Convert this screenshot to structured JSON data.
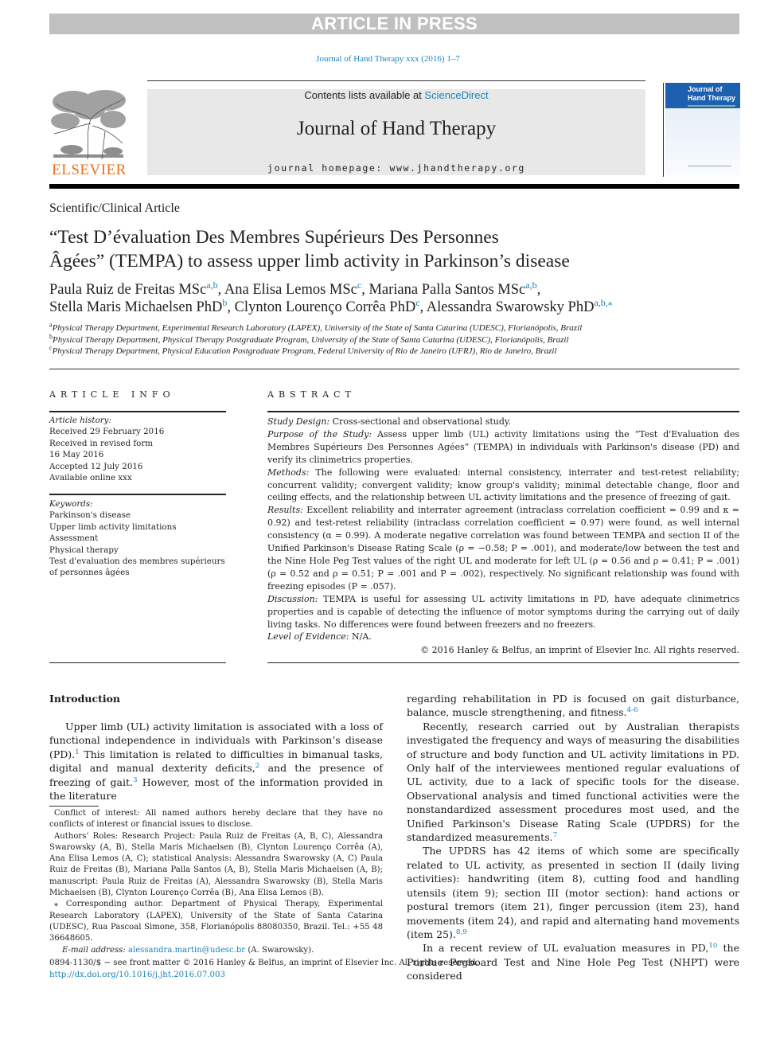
{
  "banner": {
    "text": "ARTICLE IN PRESS"
  },
  "journal_citation": "Journal of Hand Therapy xxx (2016) 1–7",
  "masthead": {
    "publisher_logo_text": "ELSEVIER",
    "contents_prefix": "Contents lists available at ",
    "contents_link": "ScienceDirect",
    "journal_title": "Journal of Hand Therapy",
    "homepage": "journal homepage: www.jhandtherapy.org",
    "cover_title_line1": "Journal of",
    "cover_title_line2": "Hand Therapy"
  },
  "article": {
    "type": "Scientific/Clinical Article",
    "title_line1": "“Test D’évaluation Des Membres Supérieurs Des Personnes",
    "title_line2": "Âgées” (TEMPA) to assess upper limb activity in Parkinson’s disease",
    "authors": [
      {
        "name": "Paula Ruiz de Freitas MSc",
        "aff": "a,b",
        "sep": ", "
      },
      {
        "name": "Ana Elisa Lemos MSc",
        "aff": "c",
        "sep": ", "
      },
      {
        "name": "Mariana Palla Santos MSc",
        "aff": "a,b",
        "sep": ","
      },
      {
        "name": "Stella Maris Michaelsen PhD",
        "aff": "b",
        "sep": ", "
      },
      {
        "name": "Clynton Lourenço Corrêa PhD",
        "aff": "c",
        "sep": ", "
      },
      {
        "name": "Alessandra Swarowsky PhD",
        "aff": "a,b,⁎",
        "sep": ""
      }
    ],
    "affiliations": [
      {
        "key": "a",
        "text": "Physical Therapy Department, Experimental Research Laboratory (LAPEX), University of the State of Santa Catarina (UDESC), Florianópolis, Brazil"
      },
      {
        "key": "b",
        "text": "Physical Therapy Department, Physical Therapy Postgraduate Program, University of the State of Santa Catarina (UDESC), Florianópolis, Brazil"
      },
      {
        "key": "c",
        "text": "Physical Therapy Department, Physical Education Postgraduate Program, Federal University of Rio de Janeiro (UFRJ), Rio de Janeiro, Brazil"
      }
    ]
  },
  "article_info": {
    "heading": "ARTICLE INFO",
    "history_label": "Article history:",
    "history": [
      "Received 29 February 2016",
      "Received in revised form",
      "16 May 2016",
      "Accepted 12 July 2016",
      "Available online xxx"
    ],
    "keywords_label": "Keywords:",
    "keywords": [
      "Parkinson's disease",
      "Upper limb activity limitations",
      "Assessment",
      "Physical therapy",
      "Test d'evaluation des membres supérieurs",
      "of personnes âgées"
    ]
  },
  "abstract": {
    "heading": "ABSTRACT",
    "sections": [
      {
        "label": "Study Design:",
        "text": " Cross-sectional and observational study."
      },
      {
        "label": "Purpose of the Study:",
        "text": " Assess upper limb (UL) activity limitations using the “Test d'Evaluation des Membres Supérieurs Des Personnes Agées” (TEMPA) in individuals with Parkinson's disease (PD) and verify its clinimetrics properties."
      },
      {
        "label": "Methods:",
        "text": " The following were evaluated: internal consistency, interrater and test-retest reliability; concurrent validity; convergent validity; know group's validity; minimal detectable change, floor and ceiling effects, and the relationship between UL activity limitations and the presence of freezing of gait."
      },
      {
        "label": "Results:",
        "text": " Excellent reliability and interrater agreement (intraclass correlation coefficient = 0.99 and κ = 0.92) and test-retest reliability (intraclass correlation coefficient = 0.97) were found, as well internal consistency (α = 0.99). A moderate negative correlation was found between TEMPA and section II of the Unified Parkinson's Disease Rating Scale (ρ = −0.58; P = .001), and moderate/low between the test and the Nine Hole Peg Test values of the right UL and moderate for left UL (ρ = 0.56 and ρ = 0.41; P = .001) (ρ = 0.52 and ρ = 0.51; P = .001 and P = .002), respectively. No significant relationship was found with freezing episodes (P = .057)."
      },
      {
        "label": "Discussion:",
        "text": " TEMPA is useful for assessing UL activity limitations in PD, have adequate clinimetrics properties and is capable of detecting the influence of motor symptoms during the carrying out of daily living tasks. No differences were found between freezers and no freezers."
      },
      {
        "label": "Level of Evidence:",
        "text": " N/A."
      }
    ],
    "copyright": "© 2016 Hanley & Belfus, an imprint of Elsevier Inc. All rights reserved."
  },
  "introduction": {
    "heading": "Introduction",
    "left_para": {
      "t1": "Upper limb (UL) activity limitation is associated with a loss of functional independence in individuals with Parkinson’s disease (PD).",
      "r1": "1",
      "t2": " This limitation is related to difficulties in bimanual tasks, digital and manual dexterity deficits,",
      "r2": "2",
      "t3": " and the presence of freezing of gait.",
      "r3": "3",
      "t4": " However, most of the information provided in the literature"
    },
    "right_paras": [
      {
        "t1": "regarding rehabilitation in PD is focused on gait disturbance, balance, muscle strengthening, and fitness.",
        "r1": "4-6"
      },
      {
        "t1": "Recently, research carried out by Australian therapists investigated the frequency and ways of measuring the disabilities of structure and body function and UL activity limitations in PD. Only half of the interviewees mentioned regular evaluations of UL activity, due to a lack of specific tools for the disease. Observational analysis and timed functional activities were the nonstandardized assessment procedures most used, and the Unified Parkinson's Disease Rating Scale (UPDRS) for the standardized measurements.",
        "r1": "7"
      },
      {
        "t1": "The UPDRS has 42 items of which some are specifically related to UL activity, as presented in section II (daily living activities): handwriting (item 8), cutting food and handling utensils (item 9); section III (motor section): hand actions or postural tremors (item 21), finger percussion (item 23), hand movements (item 24), and rapid and alternating hand movements (item 25).",
        "r1": "8,9"
      },
      {
        "t1": "In a recent review of UL evaluation measures in PD,",
        "r1": "10",
        "t2": " the Purdue Pegboard Test and Nine Hole Peg Test (NHPT) were considered"
      }
    ]
  },
  "footnotes": {
    "conflict": "Conflict of interest: All named authors hereby declare that they have no conflicts of interest or financial issues to disclose.",
    "roles": "Authors’ Roles: Research Project: Paula Ruiz de Freitas (A, B, C), Alessandra Swarowsky (A, B), Stella Maris Michaelsen (B), Clynton Lourenço Corrêa (A), Ana Elisa Lemos (A, C); statistical Analysis: Alessandra Swarowsky (A, C) Paula Ruiz de Freitas (B), Mariana Palla Santos (A, B), Stella Maris Michaelsen (A, B); manuscript: Paula Ruiz de Freitas (A), Alessandra Swarowsky (B), Stella Maris Michaelsen (B), Clynton Lourenço Corrêa (B), Ana Elisa Lemos (B).",
    "corresponding": "⁎ Corresponding author. Department of Physical Therapy, Experimental Research Laboratory (LAPEX), University of the State of Santa Catarina (UDESC), Rua Pascoal Simone, 358, Florianópolis 88080350, Brazil. Tel.: +55 48 36648605.",
    "email_label": "E-mail address:",
    "email": "alessandra.martin@udesc.br",
    "email_suffix": " (A. Swarowsky)."
  },
  "bottom_meta": {
    "issn_line": "0894-1130/$ − see front matter © 2016 Hanley & Belfus, an imprint of Elsevier Inc. All rights reserved.",
    "doi": "http://dx.doi.org/10.1016/j.jht.2016.07.003"
  },
  "colors": {
    "link": "#1a85b8",
    "elsevier_orange": "#e9711c",
    "banner_gray": "#c0c0c1",
    "masthead_gray": "#e8e8e8",
    "cover_blue": "#1d60b0"
  }
}
